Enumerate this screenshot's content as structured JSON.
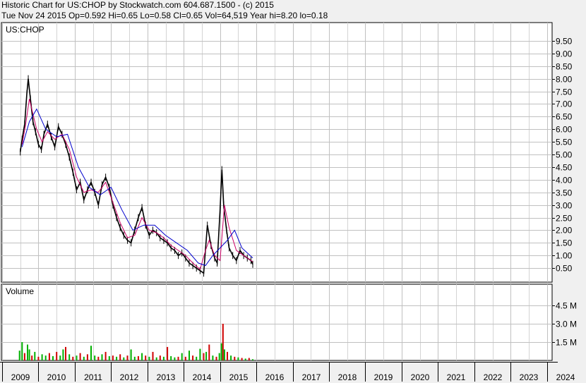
{
  "header": {
    "line1": "Historic Chart for US:CHOP by Stockwatch.com 604.687.1500 - (c) 2015",
    "line2": "Tue Nov 24 2015  Op=0.592  Hi=0.65  Lo=0.58  Cl=0.65  Vol=64,519  Year hi=8.20  lo=0.18"
  },
  "chart_data": [
    {
      "type": "line",
      "title": "US:CHOP",
      "ylim": [
        0,
        10
      ],
      "yticks": [
        "0.50",
        "1.00",
        "1.50",
        "2.00",
        "2.50",
        "3.00",
        "3.50",
        "4.00",
        "4.50",
        "5.00",
        "5.50",
        "6.00",
        "6.50",
        "7.00",
        "7.50",
        "8.00",
        "8.50",
        "9.00",
        "9.50"
      ],
      "ytick_values": [
        0.5,
        1,
        1.5,
        2,
        2.5,
        3,
        3.5,
        4,
        4.5,
        5,
        5.5,
        6,
        6.5,
        7,
        7.5,
        8,
        8.5,
        9,
        9.5
      ],
      "grid": true,
      "series": [
        {
          "role": "price",
          "color": "#000000",
          "x": [
            2009.5,
            2009.55,
            2009.62,
            2009.68,
            2009.72,
            2009.78,
            2009.85,
            2009.92,
            2010.0,
            2010.08,
            2010.15,
            2010.25,
            2010.35,
            2010.45,
            2010.55,
            2010.65,
            2010.75,
            2010.85,
            2010.95,
            2011.05,
            2011.15,
            2011.25,
            2011.35,
            2011.45,
            2011.55,
            2011.65,
            2011.75,
            2011.85,
            2011.95,
            2012.05,
            2012.15,
            2012.25,
            2012.35,
            2012.45,
            2012.55,
            2012.65,
            2012.75,
            2012.85,
            2012.95,
            2013.05,
            2013.15,
            2013.25,
            2013.35,
            2013.45,
            2013.55,
            2013.65,
            2013.75,
            2013.85,
            2013.95,
            2014.05,
            2014.15,
            2014.25,
            2014.35,
            2014.45,
            2014.55,
            2014.65,
            2014.75,
            2014.85,
            2014.92,
            2015.0,
            2015.05,
            2015.1,
            2015.18,
            2015.25,
            2015.35,
            2015.45,
            2015.55,
            2015.65,
            2015.75,
            2015.85,
            2015.9
          ],
          "values": [
            5.1,
            5.6,
            6.2,
            7.4,
            8.0,
            7.2,
            6.3,
            5.9,
            5.4,
            5.2,
            5.8,
            6.2,
            5.7,
            5.3,
            6.1,
            5.8,
            5.4,
            4.9,
            4.3,
            3.6,
            3.9,
            3.2,
            3.6,
            3.9,
            3.5,
            3.0,
            3.8,
            4.1,
            3.7,
            3.0,
            2.5,
            2.1,
            1.8,
            1.6,
            1.5,
            2.0,
            2.5,
            2.9,
            2.2,
            1.8,
            2.0,
            1.9,
            1.7,
            1.6,
            1.5,
            1.3,
            1.2,
            1.0,
            1.1,
            0.9,
            0.7,
            0.6,
            0.5,
            0.4,
            0.3,
            2.2,
            1.4,
            0.9,
            0.7,
            2.8,
            4.4,
            3.0,
            2.0,
            1.3,
            1.0,
            0.8,
            1.2,
            1.0,
            0.9,
            0.8,
            0.65
          ]
        },
        {
          "role": "moving-average-short",
          "color": "#cc0066",
          "x": [
            2009.55,
            2009.65,
            2009.75,
            2009.85,
            2009.95,
            2010.1,
            2010.25,
            2010.45,
            2010.65,
            2010.85,
            2011.05,
            2011.25,
            2011.45,
            2011.65,
            2011.85,
            2012.05,
            2012.25,
            2012.45,
            2012.65,
            2012.85,
            2013.05,
            2013.25,
            2013.45,
            2013.65,
            2013.85,
            2014.05,
            2014.25,
            2014.45,
            2014.6,
            2014.7,
            2014.85,
            2015.0,
            2015.12,
            2015.25,
            2015.45,
            2015.65,
            2015.9
          ],
          "values": [
            5.4,
            6.2,
            7.2,
            6.6,
            6.0,
            5.5,
            5.9,
            5.6,
            5.8,
            5.2,
            4.1,
            3.5,
            3.6,
            3.5,
            3.9,
            3.1,
            2.3,
            1.7,
            1.8,
            2.5,
            2.0,
            1.9,
            1.7,
            1.4,
            1.2,
            1.0,
            0.7,
            0.45,
            1.2,
            1.6,
            1.0,
            0.8,
            3.0,
            2.1,
            1.2,
            1.0,
            0.75
          ]
        },
        {
          "role": "moving-average-long",
          "color": "#0000cc",
          "x": [
            2009.55,
            2009.75,
            2009.95,
            2010.2,
            2010.5,
            2010.8,
            2011.1,
            2011.4,
            2011.7,
            2012.0,
            2012.3,
            2012.6,
            2012.9,
            2013.2,
            2013.5,
            2013.8,
            2014.1,
            2014.4,
            2014.6,
            2014.8,
            2015.0,
            2015.2,
            2015.4,
            2015.6,
            2015.9
          ],
          "values": [
            5.3,
            6.3,
            6.8,
            6.0,
            5.7,
            5.8,
            4.5,
            3.7,
            3.4,
            3.7,
            2.8,
            2.0,
            2.2,
            2.2,
            1.8,
            1.5,
            1.2,
            0.7,
            0.6,
            1.0,
            1.3,
            1.6,
            2.0,
            1.3,
            0.9
          ]
        }
      ]
    },
    {
      "type": "bar",
      "title": "Volume",
      "ylim": [
        0,
        6000000
      ],
      "yticks": [
        "1.5 M",
        "3.0 M",
        "4.5 M"
      ],
      "ytick_values": [
        1500000,
        3000000,
        4500000
      ],
      "grid": true,
      "bar_colors": [
        "#00b000",
        "#d00000"
      ],
      "x": [
        2009.48,
        2009.55,
        2009.62,
        2009.7,
        2009.75,
        2009.82,
        2009.9,
        2010.0,
        2010.1,
        2010.2,
        2010.3,
        2010.4,
        2010.5,
        2010.6,
        2010.68,
        2010.75,
        2010.85,
        2010.95,
        2011.05,
        2011.15,
        2011.25,
        2011.35,
        2011.45,
        2011.55,
        2011.65,
        2011.75,
        2011.85,
        2011.95,
        2012.05,
        2012.15,
        2012.25,
        2012.35,
        2012.45,
        2012.55,
        2012.65,
        2012.75,
        2012.85,
        2012.95,
        2013.05,
        2013.15,
        2013.25,
        2013.35,
        2013.45,
        2013.55,
        2013.65,
        2013.75,
        2013.85,
        2013.95,
        2014.05,
        2014.15,
        2014.25,
        2014.35,
        2014.45,
        2014.55,
        2014.62,
        2014.7,
        2014.8,
        2014.9,
        2014.98,
        2015.04,
        2015.08,
        2015.12,
        2015.2,
        2015.3,
        2015.4,
        2015.5,
        2015.6,
        2015.7,
        2015.8,
        2015.9
      ],
      "values": [
        800000,
        1500000,
        600000,
        1300000,
        900000,
        400000,
        700000,
        300000,
        500000,
        400000,
        600000,
        350000,
        700000,
        400000,
        900000,
        1100000,
        500000,
        300000,
        400000,
        600000,
        300000,
        500000,
        1200000,
        400000,
        300000,
        500000,
        700000,
        350000,
        400000,
        300000,
        500000,
        250000,
        400000,
        900000,
        300000,
        350000,
        600000,
        400000,
        300000,
        700000,
        250000,
        400000,
        300000,
        1100000,
        350000,
        250000,
        300000,
        600000,
        300000,
        800000,
        400000,
        300000,
        950000,
        600000,
        700000,
        1300000,
        400000,
        300000,
        600000,
        1400000,
        3000000,
        900000,
        700000,
        400000,
        300000,
        250000,
        200000,
        150000,
        200000,
        100000
      ],
      "up": [
        true,
        true,
        false,
        true,
        true,
        false,
        true,
        false,
        true,
        true,
        false,
        true,
        false,
        true,
        true,
        false,
        true,
        false,
        true,
        false,
        true,
        false,
        true,
        true,
        false,
        true,
        false,
        true,
        false,
        true,
        false,
        true,
        false,
        true,
        true,
        false,
        true,
        false,
        true,
        false,
        true,
        false,
        true,
        false,
        true,
        true,
        false,
        true,
        false,
        true,
        false,
        true,
        true,
        false,
        true,
        false,
        true,
        false,
        true,
        true,
        false,
        true,
        false,
        true,
        false,
        true,
        false,
        true,
        false,
        true
      ]
    }
  ],
  "x_axis": {
    "labels": [
      "2009",
      "2010",
      "2011",
      "2012",
      "2013",
      "2014",
      "2015",
      "2016",
      "2017",
      "2018",
      "2019",
      "2020",
      "2021",
      "2022",
      "2023",
      "2024"
    ],
    "positions": [
      2009,
      2010,
      2011,
      2012,
      2013,
      2014,
      2015,
      2016,
      2017,
      2018,
      2019,
      2020,
      2021,
      2022,
      2023,
      2024
    ],
    "range": [
      2009,
      2024.2
    ]
  }
}
